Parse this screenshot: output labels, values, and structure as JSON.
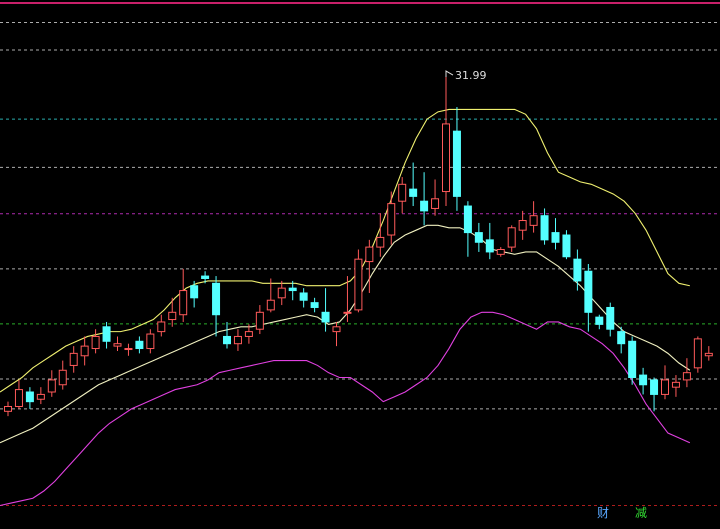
{
  "colors": {
    "background": "#000000",
    "up": "#ff5a5a",
    "down": "#54ffff",
    "upper_band": "#f0f070",
    "middle_band": "#f0f0c0",
    "lower_band": "#e040e0",
    "frame_top": "#c8206a",
    "grid_cyan": "#33cccc",
    "grid_magenta": "#cc33cc",
    "grid_green": "#33cc33",
    "grid_white": "#cccccc",
    "grid_red": "#cc2222",
    "badge_cai": "#5aa8ff",
    "badge_jian": "#33dd33"
  },
  "badges": {
    "cai": "财",
    "jian": "减"
  },
  "chart_data": {
    "type": "candlestick",
    "ylim": [
      13.4,
      34.6
    ],
    "high_marker": {
      "index": 23,
      "value": 31.99,
      "label": "31.99"
    },
    "grid_levels": [
      {
        "value": 34.0,
        "color": "grid_white"
      },
      {
        "value": 32.86,
        "color": "grid_white"
      },
      {
        "value": 30.0,
        "color": "grid_cyan"
      },
      {
        "value": 28.0,
        "color": "grid_white"
      },
      {
        "value": 26.08,
        "color": "grid_magenta"
      },
      {
        "value": 23.8,
        "color": "grid_white"
      },
      {
        "value": 21.52,
        "color": "grid_green"
      },
      {
        "value": 19.24,
        "color": "grid_white"
      },
      {
        "value": 18.0,
        "color": "grid_white"
      },
      {
        "value": 14.0,
        "color": "grid_red"
      }
    ],
    "candles": [
      [
        17.9,
        18.3,
        17.7,
        18.1
      ],
      [
        18.1,
        19.2,
        18.0,
        18.8
      ],
      [
        18.7,
        18.9,
        18.0,
        18.3
      ],
      [
        18.4,
        18.9,
        18.2,
        18.6
      ],
      [
        18.7,
        19.6,
        18.5,
        19.2
      ],
      [
        19.0,
        20.0,
        18.8,
        19.6
      ],
      [
        19.8,
        20.6,
        19.5,
        20.3
      ],
      [
        20.2,
        21.0,
        19.8,
        20.6
      ],
      [
        20.5,
        21.3,
        20.3,
        21.0
      ],
      [
        21.4,
        21.6,
        20.5,
        20.8
      ],
      [
        20.6,
        21.0,
        20.4,
        20.7
      ],
      [
        20.5,
        20.7,
        20.2,
        20.5
      ],
      [
        20.8,
        21.0,
        20.3,
        20.5
      ],
      [
        20.5,
        21.3,
        20.3,
        21.1
      ],
      [
        21.2,
        21.9,
        21.0,
        21.6
      ],
      [
        21.7,
        22.6,
        21.4,
        22.0
      ],
      [
        21.9,
        23.8,
        21.6,
        22.9
      ],
      [
        23.1,
        23.3,
        22.2,
        22.6
      ],
      [
        23.5,
        23.7,
        23.2,
        23.4
      ],
      [
        23.2,
        23.5,
        21.0,
        21.9
      ],
      [
        21.0,
        21.6,
        20.5,
        20.7
      ],
      [
        20.7,
        21.3,
        20.4,
        21.0
      ],
      [
        21.0,
        21.5,
        20.7,
        21.2
      ]
    ],
    "candles_b": [
      [
        21.3,
        22.3,
        21.1,
        22.0
      ],
      [
        22.1,
        23.4,
        22.0,
        22.5
      ],
      [
        22.6,
        23.3,
        22.3,
        23.0
      ],
      [
        23.0,
        23.3,
        22.5,
        22.9
      ],
      [
        22.8,
        23.0,
        22.2,
        22.5
      ],
      [
        22.4,
        22.6,
        22.0,
        22.2
      ],
      [
        22.0,
        23.0,
        21.2,
        21.6
      ],
      [
        21.2,
        21.6,
        20.6,
        21.4
      ],
      [
        22.0,
        23.5,
        21.6,
        22.0
      ]
    ],
    "candles_c": [
      [
        22.1,
        24.6,
        22.0,
        24.2
      ],
      [
        24.1,
        25.0,
        22.8,
        24.7
      ],
      [
        24.7,
        26.1,
        24.3,
        25.1
      ],
      [
        25.2,
        27.0,
        24.8,
        26.5
      ],
      [
        26.6,
        27.6,
        26.1,
        27.3
      ],
      [
        27.1,
        28.2,
        26.4,
        26.8
      ],
      [
        26.6,
        27.8,
        25.6,
        26.2
      ],
      [
        26.3,
        27.5,
        26.0,
        26.7
      ],
      [
        27.0,
        31.99,
        26.4,
        29.8
      ],
      [
        29.5,
        30.5,
        26.2,
        26.8
      ],
      [
        26.4,
        26.6,
        24.3,
        25.3
      ],
      [
        25.3,
        25.7,
        24.5,
        24.9
      ],
      [
        25.0,
        25.7,
        24.2,
        24.5
      ],
      [
        24.4,
        24.7,
        24.3,
        24.6
      ],
      [
        24.7,
        25.6,
        24.5,
        25.5
      ],
      [
        25.4,
        26.2,
        25.0,
        25.8
      ],
      [
        25.6,
        26.6,
        25.3,
        26.0
      ],
      [
        26.0,
        26.3,
        24.8,
        25.0
      ],
      [
        25.3,
        25.9,
        24.6,
        24.9
      ],
      [
        25.2,
        25.4,
        24.2,
        24.3
      ],
      [
        24.2,
        24.6,
        22.9,
        23.3
      ],
      [
        23.7,
        24.0,
        21.2,
        22.0
      ],
      [
        21.8,
        21.9,
        21.3,
        21.5
      ],
      [
        22.2,
        22.4,
        21.0,
        21.3
      ],
      [
        21.2,
        21.4,
        20.3,
        20.7
      ],
      [
        20.8,
        21.0,
        19.0,
        19.3
      ],
      [
        19.4,
        19.7,
        18.6,
        19.0
      ],
      [
        19.2,
        19.3,
        17.9,
        18.6
      ],
      [
        18.6,
        19.8,
        18.4,
        19.2
      ],
      [
        18.9,
        19.4,
        18.5,
        19.1
      ],
      [
        19.2,
        20.1,
        18.9,
        19.5
      ],
      [
        19.7,
        21.0,
        19.5,
        20.9
      ],
      [
        20.2,
        20.6,
        20.0,
        20.3
      ]
    ],
    "upper_band": [
      18.7,
      19.0,
      19.3,
      19.7,
      20.0,
      20.3,
      20.6,
      20.8,
      21.0,
      21.1,
      21.2,
      21.2,
      21.3,
      21.5,
      21.7,
      22.1,
      22.6,
      23.0,
      23.2,
      23.3,
      23.3,
      23.3,
      23.3,
      23.3,
      23.2,
      23.2,
      23.2,
      23.2,
      23.1,
      23.1,
      23.1,
      23.1,
      23.3,
      23.8,
      24.7,
      25.8,
      27.0,
      28.2,
      29.2,
      30.0,
      30.3,
      30.4,
      30.4,
      30.4,
      30.4,
      30.4,
      30.4,
      30.4,
      30.2,
      29.6,
      28.6,
      27.8,
      27.6,
      27.4,
      27.3,
      27.1,
      26.9,
      26.6,
      26.1,
      25.4,
      24.5,
      23.6,
      23.2,
      23.1
    ],
    "middle_band": [
      16.6,
      16.8,
      17.0,
      17.2,
      17.5,
      17.8,
      18.1,
      18.4,
      18.7,
      19.0,
      19.2,
      19.4,
      19.6,
      19.8,
      20.0,
      20.2,
      20.4,
      20.6,
      20.8,
      21.0,
      21.2,
      21.3,
      21.4,
      21.4,
      21.5,
      21.6,
      21.7,
      21.8,
      21.9,
      21.8,
      21.5,
      21.6,
      22.1,
      22.8,
      23.6,
      24.3,
      24.9,
      25.2,
      25.4,
      25.6,
      25.6,
      25.5,
      25.5,
      25.3,
      25.0,
      24.6,
      24.5,
      24.4,
      24.5,
      24.5,
      24.2,
      23.9,
      23.5,
      23.1,
      22.6,
      22.1,
      21.6,
      21.2,
      21.0,
      20.8,
      20.6,
      20.3,
      19.9,
      19.6
    ],
    "lower_band": [
      14.0,
      14.1,
      14.2,
      14.3,
      14.6,
      15.0,
      15.5,
      16.0,
      16.5,
      17.0,
      17.4,
      17.7,
      18.0,
      18.2,
      18.4,
      18.6,
      18.8,
      18.9,
      19.0,
      19.2,
      19.5,
      19.6,
      19.7,
      19.8,
      19.9,
      20.0,
      20.0,
      20.0,
      20.0,
      19.8,
      19.5,
      19.3,
      19.3,
      19.0,
      18.7,
      18.3,
      18.5,
      18.7,
      19.0,
      19.3,
      19.8,
      20.5,
      21.3,
      21.8,
      22.0,
      22.0,
      21.9,
      21.7,
      21.5,
      21.3,
      21.6,
      21.6,
      21.4,
      21.3,
      21.0,
      20.7,
      20.3,
      19.7,
      19.0,
      18.2,
      17.6,
      17.0,
      16.8,
      16.6
    ]
  }
}
